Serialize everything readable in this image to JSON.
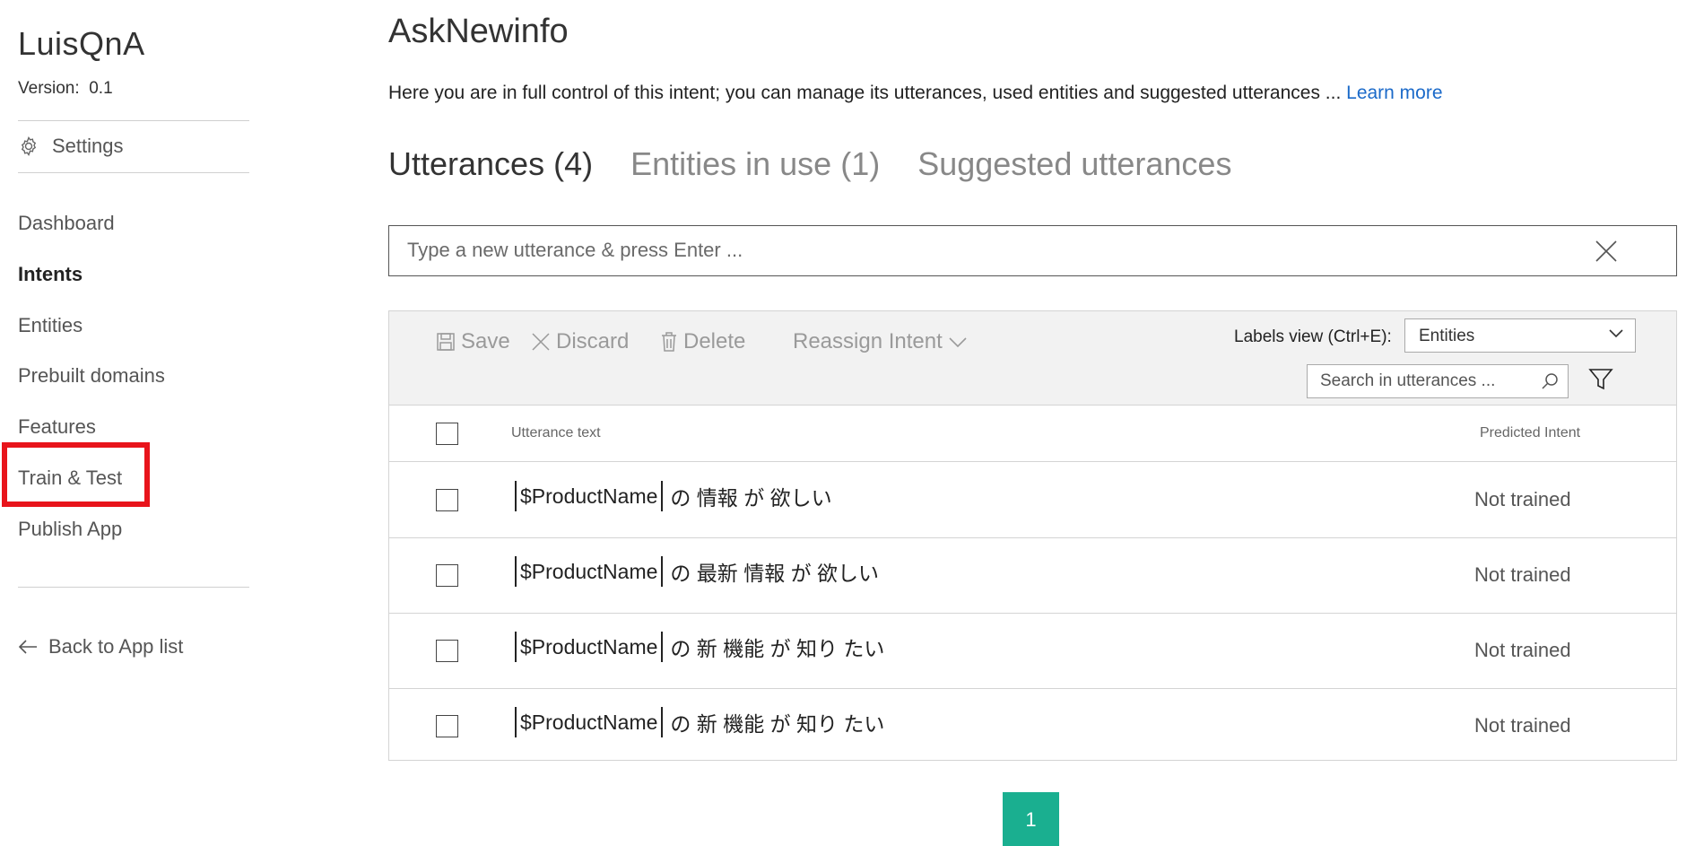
{
  "app": {
    "name": "LuisQnA",
    "version_label": "Version:",
    "version": "0.1"
  },
  "sidebar": {
    "settings_label": "Settings",
    "items": [
      {
        "label": "Dashboard",
        "active": false
      },
      {
        "label": "Intents",
        "active": true
      },
      {
        "label": "Entities",
        "active": false
      },
      {
        "label": "Prebuilt domains",
        "active": false
      },
      {
        "label": "Features",
        "active": false
      },
      {
        "label": "Train & Test",
        "active": false,
        "highlighted": true
      },
      {
        "label": "Publish App",
        "active": false
      }
    ],
    "back_label": "Back to App list",
    "highlight_color": "#e8141b"
  },
  "main": {
    "title": "AskNewinfo",
    "description": "Here you are in full control of this intent; you can manage its utterances, used entities and suggested utterances ...",
    "learn_more": "Learn more",
    "tabs": [
      {
        "label": "Utterances (4)",
        "active": true
      },
      {
        "label": "Entities in use (1)",
        "active": false
      },
      {
        "label": "Suggested utterances",
        "active": false
      }
    ],
    "utterance_input": {
      "placeholder": "Type a new utterance & press Enter ...",
      "value": ""
    },
    "toolbar": {
      "save": "Save",
      "discard": "Discard",
      "delete": "Delete",
      "reassign": "Reassign Intent",
      "labels_view_label": "Labels view (Ctrl+E):",
      "labels_view_value": "Entities",
      "search_placeholder": "Search in utterances ..."
    },
    "table": {
      "columns": {
        "utterance": "Utterance text",
        "predicted": "Predicted Intent"
      },
      "rows": [
        {
          "entity": "$ProductName",
          "text": "の 情報 が 欲しい",
          "predicted": "Not trained"
        },
        {
          "entity": "$ProductName",
          "text": "の 最新 情報 が 欲しい",
          "predicted": "Not trained"
        },
        {
          "entity": "$ProductName",
          "text": "の 新 機能 が 知り たい",
          "predicted": "Not trained"
        },
        {
          "entity": "$ProductName",
          "text": "の 新 機能 が 知り たい",
          "predicted": "Not trained"
        }
      ]
    },
    "pagination": {
      "current": "1",
      "color": "#1aaf90"
    }
  }
}
